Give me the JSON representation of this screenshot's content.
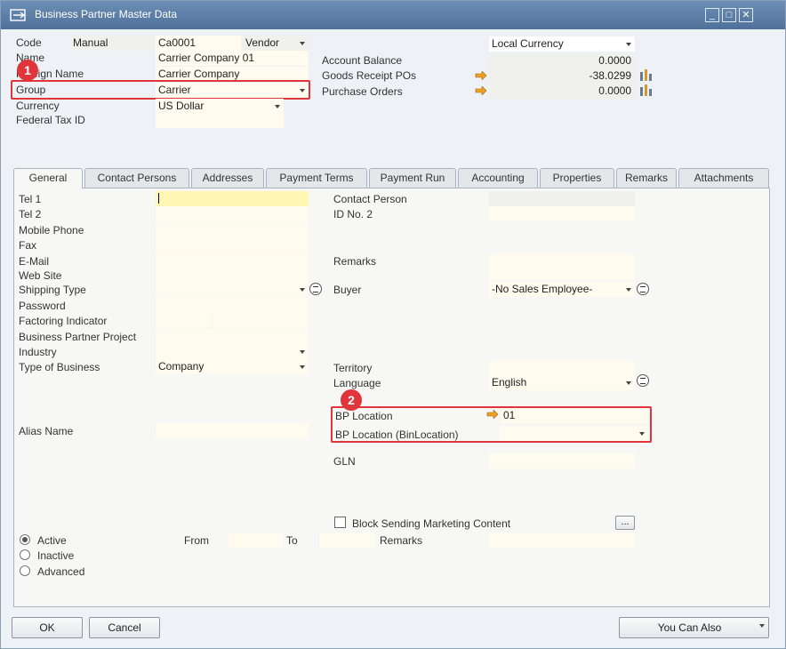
{
  "window": {
    "title": "Business Partner Master Data",
    "min": "_",
    "max": "□",
    "close": "✕"
  },
  "header": {
    "code_label": "Code",
    "code_series": "Manual",
    "code_value": "Ca0001",
    "bp_type": "Vendor",
    "name_label": "Name",
    "name_value": "Carrier Company 01",
    "foreign_name_label": "Foreign Name",
    "foreign_name_value": "Carrier Company",
    "group_label": "Group",
    "group_value": "Carrier",
    "currency_label": "Currency",
    "currency_value": "US Dollar",
    "federal_tax_label": "Federal Tax ID",
    "local_currency": "Local Currency",
    "account_balance_label": "Account Balance",
    "account_balance_value": "0.0000",
    "goods_receipt_label": "Goods Receipt POs",
    "goods_receipt_value": "-38.0299",
    "purchase_orders_label": "Purchase Orders",
    "purchase_orders_value": "0.0000"
  },
  "tabs": [
    "General",
    "Contact Persons",
    "Addresses",
    "Payment Terms",
    "Payment Run",
    "Accounting",
    "Properties",
    "Remarks",
    "Attachments"
  ],
  "general": {
    "tel1": "Tel 1",
    "tel2": "Tel 2",
    "mobile": "Mobile Phone",
    "fax": "Fax",
    "email": "E-Mail",
    "website": "Web Site",
    "shipping_type": "Shipping Type",
    "password": "Password",
    "factoring": "Factoring Indicator",
    "bp_project": "Business Partner Project",
    "industry": "Industry",
    "type_of_business": "Type of Business",
    "type_of_business_value": "Company",
    "alias_name": "Alias Name",
    "contact_person": "Contact Person",
    "id_no2": "ID No. 2",
    "remarks": "Remarks",
    "buyer": "Buyer",
    "buyer_value": "-No Sales Employee-",
    "territory": "Territory",
    "language": "Language",
    "language_value": "English",
    "bp_location": "BP Location",
    "bp_location_value": "01",
    "bp_location_bin": "BP Location (BinLocation)",
    "gln": "GLN",
    "block_marketing": "Block Sending Marketing Content",
    "ellipsis": "...",
    "active": "Active",
    "inactive": "Inactive",
    "advanced": "Advanced",
    "from": "From",
    "to": "To",
    "remarks2": "Remarks"
  },
  "badges": [
    "1",
    "2"
  ],
  "footer": {
    "ok": "OK",
    "cancel": "Cancel",
    "you_can_also": "You Can Also"
  },
  "colors": {
    "highlight": "#e0353b",
    "field": "#fffcef",
    "focus_field": "#fff6b3",
    "title_bar": "#5a7ba4"
  }
}
